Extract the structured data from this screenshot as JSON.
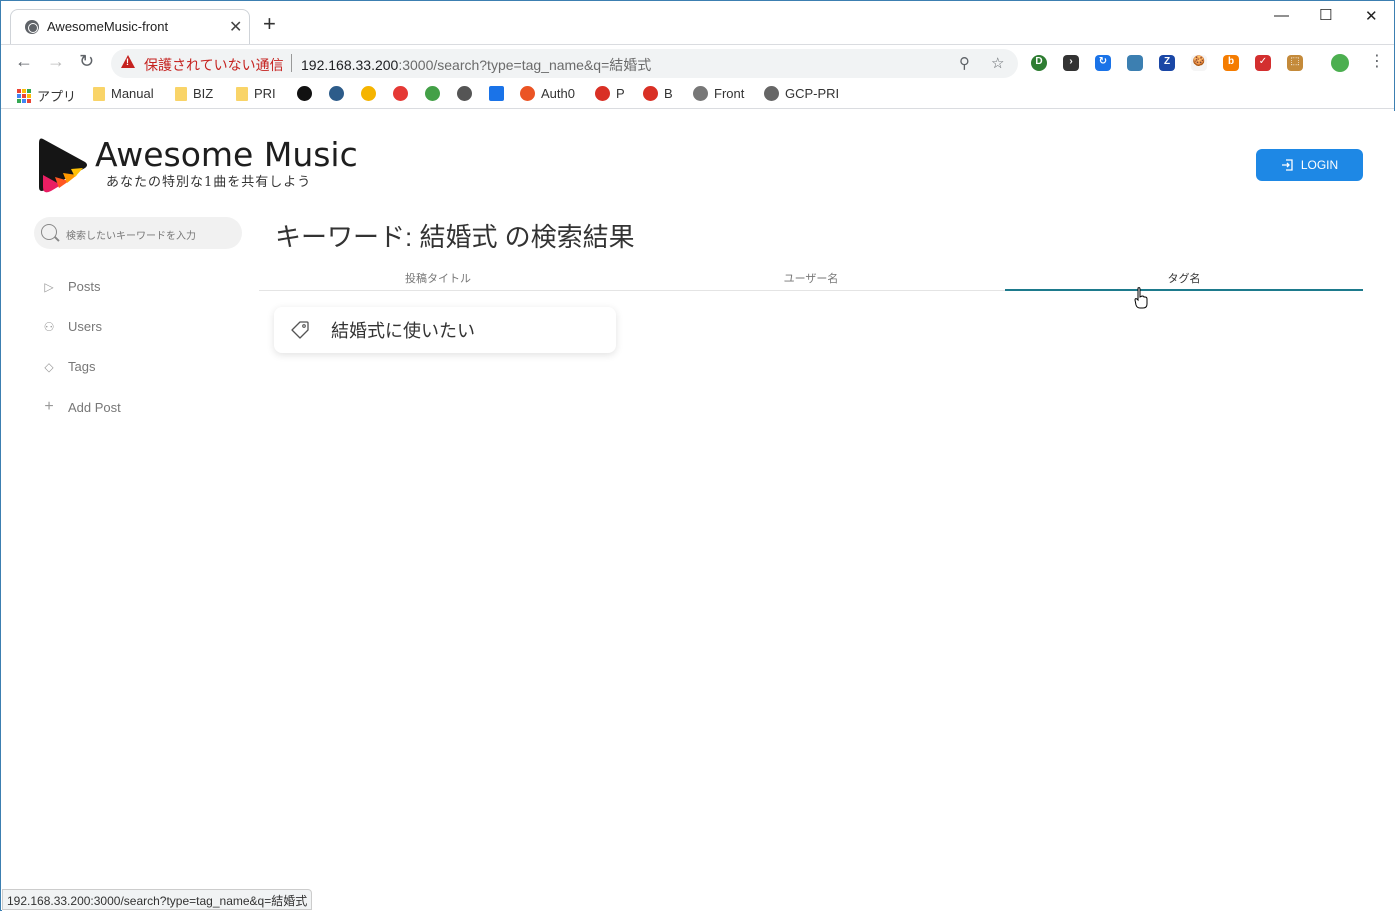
{
  "browser": {
    "tab_title": "AwesomeMusic-front",
    "new_tab": "+",
    "insecure_label": "保護されていない通信",
    "url_host": "192.168.33.200",
    "url_rest": ":3000/search?type=tag_name&q=結婚式",
    "extensions": [
      "D",
      "›",
      "↻",
      "New",
      "Z",
      "🍪",
      "b",
      "✓",
      "⬚",
      "●"
    ],
    "status_url": "192.168.33.200:3000/search?type=tag_name&q=結婚式"
  },
  "bookmarks": [
    {
      "label": "アプリ",
      "kind": "apps"
    },
    {
      "label": "Manual",
      "kind": "folder"
    },
    {
      "label": "BIZ",
      "kind": "folder"
    },
    {
      "label": "PRI",
      "kind": "folder"
    },
    {
      "label": "",
      "kind": "github"
    },
    {
      "label": "",
      "kind": "docker"
    },
    {
      "label": "",
      "kind": "co"
    },
    {
      "label": "",
      "kind": "red"
    },
    {
      "label": "",
      "kind": "ac"
    },
    {
      "label": "",
      "kind": "link"
    },
    {
      "label": "",
      "kind": "cal"
    },
    {
      "label": "Auth0",
      "kind": "auth0"
    },
    {
      "label": "P",
      "kind": "gmail"
    },
    {
      "label": "B",
      "kind": "gmail"
    },
    {
      "label": "Front",
      "kind": "globe"
    },
    {
      "label": "GCP-PRI",
      "kind": "gear"
    }
  ],
  "app": {
    "title": "Awesome Music",
    "subtitle": "あなたの特別な1曲を共有しよう",
    "login_label": "LOGIN",
    "search_placeholder": "検索したいキーワードを入力",
    "nav": [
      {
        "label": "Posts",
        "icon": "play-icon"
      },
      {
        "label": "Users",
        "icon": "users-icon"
      },
      {
        "label": "Tags",
        "icon": "tag-icon"
      },
      {
        "label": "Add Post",
        "icon": "plus-icon"
      }
    ],
    "heading": "キーワード: 結婚式 の検索結果",
    "search_tabs": [
      {
        "label": "投稿タイトル",
        "active": false
      },
      {
        "label": "ユーザー名",
        "active": false
      },
      {
        "label": "タグ名",
        "active": true
      }
    ],
    "results": [
      {
        "tag": "結婚式に使いたい"
      }
    ],
    "accent_color": "#1e88e5",
    "tab_ink_color": "#1d7a8c"
  }
}
